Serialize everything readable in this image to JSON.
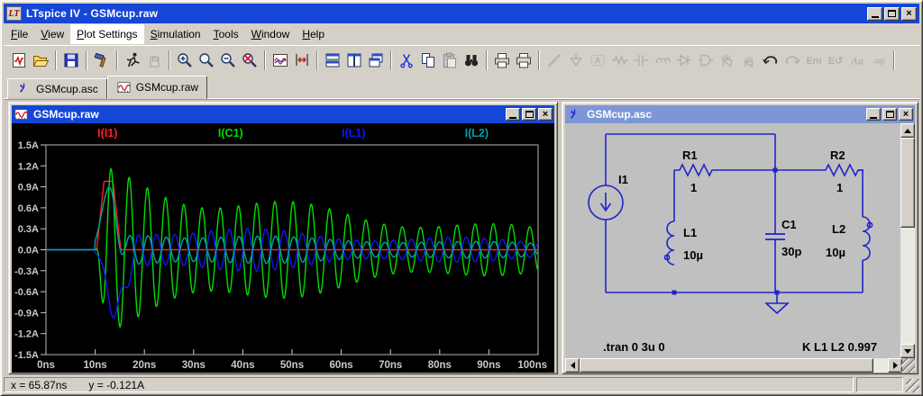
{
  "window": {
    "title": "LTspice IV - GSMcup.raw",
    "logo_text": "LT"
  },
  "menu": {
    "items": [
      {
        "label": "File",
        "underline": 0,
        "highlighted": false
      },
      {
        "label": "View",
        "underline": 0,
        "highlighted": false
      },
      {
        "label": "Plot Settings",
        "underline": 0,
        "highlighted": true
      },
      {
        "label": "Simulation",
        "underline": 0,
        "highlighted": false
      },
      {
        "label": "Tools",
        "underline": 0,
        "highlighted": false
      },
      {
        "label": "Window",
        "underline": 0,
        "highlighted": false
      },
      {
        "label": "Help",
        "underline": 0,
        "highlighted": false
      }
    ]
  },
  "toolbar": {
    "groups": [
      [
        {
          "icon": "new-schematic",
          "enabled": true
        },
        {
          "icon": "open",
          "enabled": true
        }
      ],
      [
        {
          "icon": "save",
          "enabled": true
        }
      ],
      [
        {
          "icon": "control-panel",
          "enabled": true
        }
      ],
      [
        {
          "icon": "run",
          "enabled": true
        },
        {
          "icon": "halt",
          "enabled": false
        }
      ],
      [
        {
          "icon": "zoom-in",
          "enabled": true
        },
        {
          "icon": "zoom-back",
          "enabled": true
        },
        {
          "icon": "zoom-out",
          "enabled": true
        },
        {
          "icon": "zoom-full-extents",
          "enabled": true
        }
      ],
      [
        {
          "icon": "plot-settings",
          "enabled": true
        },
        {
          "icon": "autorange",
          "enabled": true
        }
      ],
      [
        {
          "icon": "tile-horizontal",
          "enabled": true
        },
        {
          "icon": "tile-vertical",
          "enabled": true
        },
        {
          "icon": "cascade-windows",
          "enabled": true
        }
      ],
      [
        {
          "icon": "cut",
          "enabled": true
        },
        {
          "icon": "copy",
          "enabled": true
        },
        {
          "icon": "paste",
          "enabled": false
        },
        {
          "icon": "find",
          "enabled": true
        }
      ],
      [
        {
          "icon": "print-preview",
          "enabled": true
        },
        {
          "icon": "print",
          "enabled": true
        }
      ],
      [
        {
          "icon": "wire",
          "enabled": false
        },
        {
          "icon": "ground",
          "enabled": false
        },
        {
          "icon": "net-label",
          "enabled": false
        },
        {
          "icon": "resistor",
          "enabled": false
        },
        {
          "icon": "capacitor",
          "enabled": false
        },
        {
          "icon": "inductor",
          "enabled": false
        },
        {
          "icon": "diode",
          "enabled": false
        },
        {
          "icon": "component",
          "enabled": false
        },
        {
          "icon": "move",
          "enabled": false
        },
        {
          "icon": "drag",
          "enabled": false
        },
        {
          "icon": "undo",
          "enabled": true
        },
        {
          "icon": "redo",
          "enabled": false
        },
        {
          "icon": "mirror",
          "enabled": false
        },
        {
          "icon": "rotate",
          "enabled": false
        },
        {
          "icon": "text",
          "enabled": false
        },
        {
          "icon": "spice-directive",
          "enabled": false
        }
      ]
    ]
  },
  "tabs": [
    {
      "label": "GSMcup.asc",
      "icon": "schematic-doc",
      "active": false
    },
    {
      "label": "GSMcup.raw",
      "icon": "waveform-doc",
      "active": true
    }
  ],
  "plot_window": {
    "title": "GSMcup.raw"
  },
  "schematic_window": {
    "title": "GSMcup.asc",
    "components": {
      "i1": {
        "ref": "I1"
      },
      "r1": {
        "ref": "R1",
        "value": "1"
      },
      "r2": {
        "ref": "R2",
        "value": "1"
      },
      "l1": {
        "ref": "L1",
        "value": "10µ"
      },
      "l2": {
        "ref": "L2",
        "value": "10µ"
      },
      "c1": {
        "ref": "C1",
        "value": "30p"
      }
    },
    "directives": {
      "tran": ".tran 0 3u 0",
      "coupling": "K L1 L2 0.997"
    }
  },
  "status_bar": {
    "x_readout": "x = 65.87ns",
    "y_readout": "y = -0.121A"
  },
  "colors": {
    "titlebar_active": "#1546d8",
    "titlebar_inactive": "#7d96d7",
    "chrome": "#d4d0c8",
    "plot_background": "#000000",
    "schematic_background": "#c0c0c0",
    "wire_blue": "#2222c8",
    "axis_text": "#c8c8c8"
  },
  "chart_data": {
    "type": "line",
    "x_ticks": [
      "0ns",
      "10ns",
      "20ns",
      "30ns",
      "40ns",
      "50ns",
      "60ns",
      "70ns",
      "80ns",
      "90ns",
      "100ns"
    ],
    "y_ticks": [
      "1.5A",
      "1.2A",
      "0.9A",
      "0.6A",
      "0.3A",
      "0.0A",
      "-0.3A",
      "-0.6A",
      "-0.9A",
      "-1.2A",
      "-1.5A"
    ],
    "xlim": [
      0,
      100
    ],
    "ylim": [
      -1.5,
      1.5
    ],
    "x_unit": "ns",
    "y_unit": "A",
    "grid": false,
    "legend_position": "top",
    "series": [
      {
        "name": "I(I1)",
        "color": "#ff2020",
        "components": [
          {
            "kind": "pulse",
            "points": [
              [
                10.3,
                0
              ],
              [
                11.8,
                0.98
              ],
              [
                13.6,
                0.98
              ],
              [
                15.2,
                0
              ]
            ]
          }
        ]
      },
      {
        "name": "I(C1)",
        "color": "#00dc00",
        "components": [
          {
            "kind": "damped_sine",
            "start": 10,
            "amp": 1.25,
            "tau": 68,
            "period": 3.7,
            "phase": 2.4,
            "beat_depth": 0.17,
            "beat_period": 42,
            "beat_phase": 0,
            "ramp": 1.5
          }
        ]
      },
      {
        "name": "I(L1)",
        "color": "#1414ff",
        "components": [
          {
            "kind": "gauss",
            "on": 10,
            "center": 14.2,
            "sigma": 2.4,
            "amp": -0.92
          },
          {
            "kind": "damped_sine",
            "start": 10,
            "amp": 0.46,
            "tau": 80,
            "period": 3.7,
            "phase": 5.54,
            "beat_depth": 0.22,
            "beat_period": 42,
            "beat_phase": 1.2,
            "ramp": 5
          }
        ]
      },
      {
        "name": "I(L2)",
        "color": "#00a2a2",
        "components": [
          {
            "kind": "gauss",
            "on": 10,
            "center": 12.6,
            "sigma": 1.9,
            "amp": 0.86
          },
          {
            "kind": "damped_sine",
            "start": 10,
            "amp": 0.3,
            "tau": 85,
            "period": 3.7,
            "phase": 2.15,
            "beat_depth": 0.15,
            "beat_period": 42,
            "beat_phase": 0.6,
            "ramp": 5
          }
        ]
      }
    ]
  }
}
